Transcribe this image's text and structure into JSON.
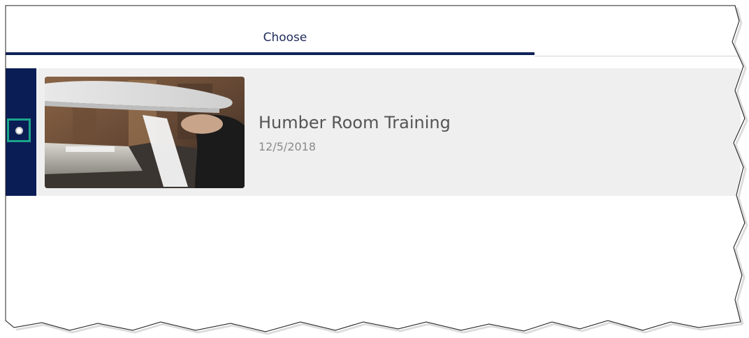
{
  "tabs": [
    {
      "label": "Choose",
      "active": true
    }
  ],
  "list": {
    "items": [
      {
        "title": "Humber Room Training",
        "date": "12/5/2018",
        "thumbnail": "waiter-carrying-plate-image",
        "selected": true
      }
    ]
  },
  "colors": {
    "accent": "#0b1d55",
    "tab_text": "#1f2a5a",
    "focus": "#1aa58a",
    "row_background": "#efefef"
  }
}
